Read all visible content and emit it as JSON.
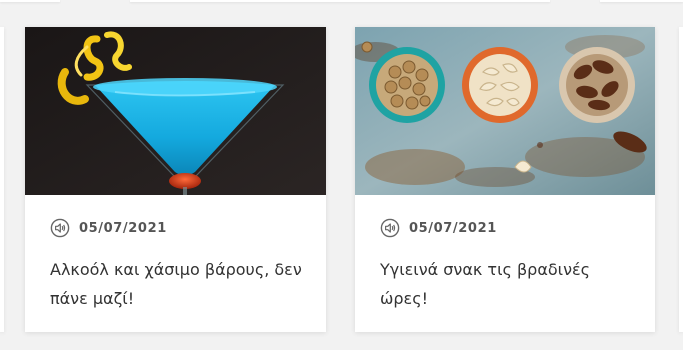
{
  "posts": [
    {
      "image_alt": "blue cocktail in martini glass with lemon peel",
      "date": "05/07/2021",
      "title": "Αλκοόλ και χάσιμο βάρους, δεν πάνε μαζί!",
      "icon": "audio-speaker-icon"
    },
    {
      "image_alt": "bowls of nuts, cashews and dates on rustic surface",
      "date": "05/07/2021",
      "title": "Υγιεινά σνακ τις βραδινές ώρες!",
      "icon": "audio-speaker-icon"
    }
  ],
  "colors": {
    "background": "#f2f2f2",
    "card": "#ffffff",
    "date_text": "#555555",
    "title_text": "#333333",
    "cocktail_blue": "#19b3e6"
  }
}
